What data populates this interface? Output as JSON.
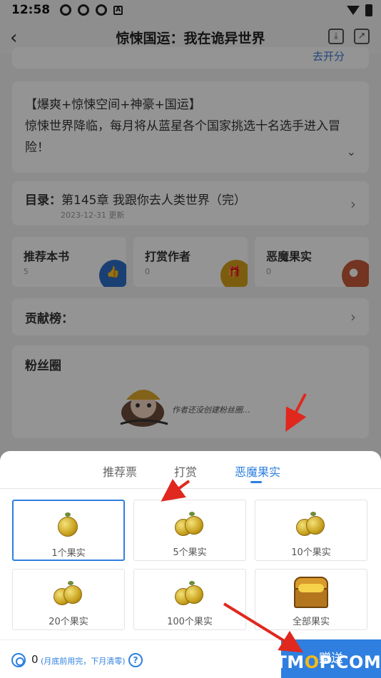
{
  "status_bar": {
    "time": "12:58",
    "badge_letter": "A"
  },
  "header": {
    "title": "惊悚国运：我在诡异世界"
  },
  "top_card": {
    "link_text": "去开分"
  },
  "description": {
    "lines": [
      "【爆爽+惊悚空间+神豪+国运】",
      "惊悚世界降临，每月将从蓝星各个国家挑选十名选手进入冒",
      "险！"
    ]
  },
  "catalog": {
    "label": "目录：",
    "chapter": "第145章 我跟你去人类世界（完）",
    "updated": "2023-12-31 更新"
  },
  "actions": [
    {
      "label": "推荐本书",
      "count": "5",
      "color": "#2e6fc6",
      "icon": "thumb-up-icon"
    },
    {
      "label": "打赏作者",
      "count": "0",
      "color": "#d6a11c",
      "icon": "gift-icon"
    },
    {
      "label": "恶魔果实",
      "count": "0",
      "color": "#c75a3a",
      "icon": "fruit-icon"
    }
  ],
  "contrib": {
    "label": "贡献榜："
  },
  "fans": {
    "label": "粉丝圈",
    "empty_hint": "作者还没创建粉丝圈…"
  },
  "sheet": {
    "tabs": [
      "推荐票",
      "打赏",
      "恶魔果实"
    ],
    "active_tab": 2,
    "options": [
      "1个果实",
      "5个果实",
      "10个果实",
      "20个果实",
      "100个果实",
      "全部果实"
    ],
    "selected_option": 0
  },
  "bottom": {
    "balance": "0",
    "note": "(月底前用完，下月清零)",
    "help": "?",
    "send_label": "赠送"
  },
  "watermark": {
    "prefix": "ITM",
    "o": "O",
    "suffix": "P.COM"
  },
  "colors": {
    "accent": "#2e7fe0",
    "arrow": "#e0281e"
  }
}
